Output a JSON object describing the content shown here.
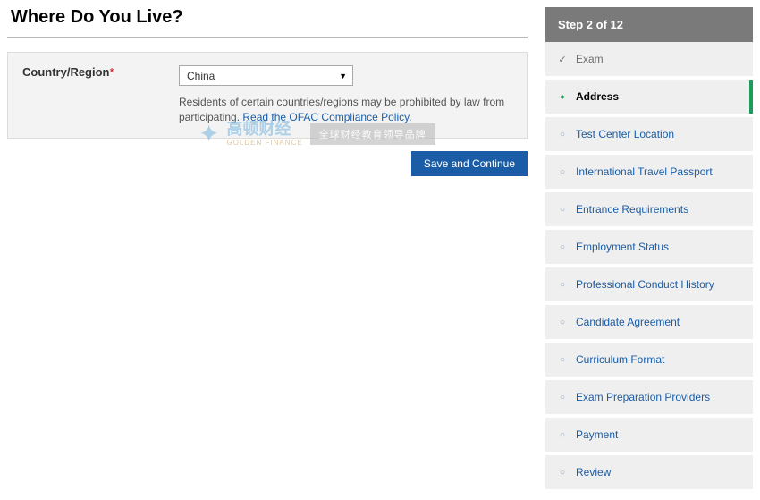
{
  "page": {
    "title": "Where Do You Live?"
  },
  "form": {
    "label": "Country/Region",
    "selected": "China",
    "helper_prefix": "Residents of certain countries/regions may be prohibited by law from participating. ",
    "helper_link": "Read the OFAC Compliance Policy.",
    "submit": "Save and Continue"
  },
  "progress": {
    "header": "Step 2 of 12",
    "steps": [
      {
        "label": "Exam",
        "state": "done"
      },
      {
        "label": "Address",
        "state": "current"
      },
      {
        "label": "Test Center Location",
        "state": "pending"
      },
      {
        "label": "International Travel Passport",
        "state": "pending"
      },
      {
        "label": "Entrance Requirements",
        "state": "pending"
      },
      {
        "label": "Employment Status",
        "state": "pending"
      },
      {
        "label": "Professional Conduct History",
        "state": "pending"
      },
      {
        "label": "Candidate Agreement",
        "state": "pending"
      },
      {
        "label": "Curriculum Format",
        "state": "pending"
      },
      {
        "label": "Exam Preparation Providers",
        "state": "pending"
      },
      {
        "label": "Payment",
        "state": "pending"
      },
      {
        "label": "Review",
        "state": "pending"
      }
    ]
  },
  "watermark": {
    "brand_cn": "高顿财经",
    "brand_en": "GOLDEN FINANCE",
    "tagline": "全球财经教育领导品牌"
  }
}
